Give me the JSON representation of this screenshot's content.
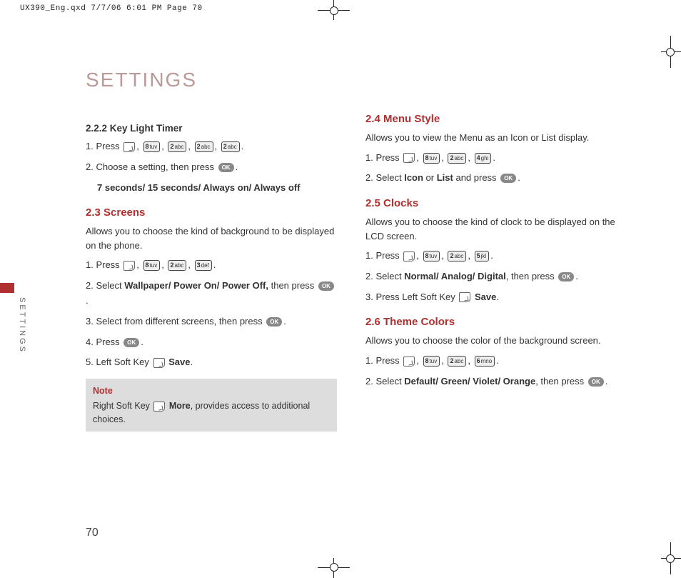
{
  "print_header": "UX390_Eng.qxd  7/7/06  6:01 PM  Page 70",
  "page_title": "SETTINGS",
  "side_tab": "SETTINGS",
  "page_number": "70",
  "ok_label": "OK",
  "keys": {
    "k2": "2",
    "k2s": "abc",
    "k3": "3",
    "k3s": "def",
    "k4": "4",
    "k4s": "ghi",
    "k5": "5",
    "k5s": "jkl",
    "k6": "6",
    "k6s": "mno",
    "k8": "8",
    "k8s": "tuv"
  },
  "left": {
    "h222": "2.2.2 Key Light Timer",
    "s222_1a": "1. Press ",
    "s222_2a": "2. Choose a setting, then press ",
    "s222_opts": "7 seconds/ 15 seconds/ Always on/ Always off",
    "h23": "2.3 Screens",
    "p23": "Allows you to choose the kind of background to be displayed on the phone.",
    "s23_1": "1. Press ",
    "s23_2a": "2. Select ",
    "s23_2b": "Wallpaper/ Power On/ Power Off,",
    "s23_2c": " then press ",
    "s23_3": "3. Select from different screens, then press ",
    "s23_4": "4. Press ",
    "s23_5a": "5. Left Soft Key ",
    "s23_5b": "Save",
    "note_t": "Note",
    "note_a": "Right Soft Key ",
    "note_b": "More",
    "note_c": ", provides access to additional choices."
  },
  "right": {
    "h24": "2.4 Menu Style",
    "p24": "Allows you to view the Menu as an Icon or List display.",
    "s24_1": "1. Press ",
    "s24_2a": "2. Select ",
    "s24_2b": "Icon",
    "s24_2c": " or ",
    "s24_2d": "List",
    "s24_2e": " and press ",
    "h25": "2.5 Clocks",
    "p25": "Allows you to choose the kind of clock to be displayed on the LCD screen.",
    "s25_1": "1. Press ",
    "s25_2a": "2. Select ",
    "s25_2b": "Normal/ Analog/ Digital",
    "s25_2c": ", then press ",
    "s25_3a": "3. Press Left Soft Key ",
    "s25_3b": "Save",
    "h26": "2.6 Theme Colors",
    "p26": "Allows you to choose the color of the background screen.",
    "s26_1": "1. Press ",
    "s26_2a": "2. Select ",
    "s26_2b": "Default/ Green/ Violet/ Orange",
    "s26_2c": ", then press "
  }
}
